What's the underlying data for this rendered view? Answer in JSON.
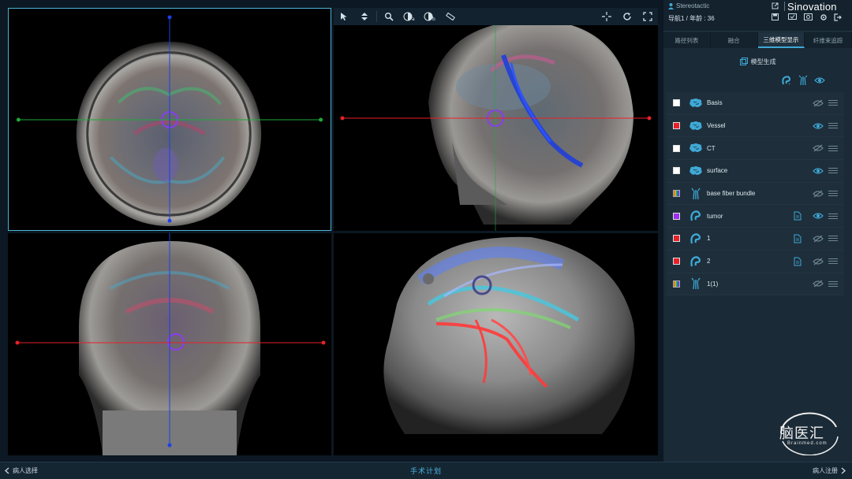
{
  "header": {
    "user": "Stereotactic",
    "patient_info": "导航1 / 年龄 : 36",
    "brand": "Sinovation"
  },
  "tabs": [
    {
      "label": "路径列表",
      "active": false
    },
    {
      "label": "融合",
      "active": false
    },
    {
      "label": "三维模型显示",
      "active": true
    },
    {
      "label": "纤维束追踪",
      "active": false
    }
  ],
  "panel": {
    "generate_label": "模型生成"
  },
  "models": [
    {
      "name": "Basis",
      "color": "#ffffff",
      "icon": "brain-icon",
      "doc": false,
      "visible": false
    },
    {
      "name": "Vessel",
      "color": "#e8202a",
      "icon": "brain-icon",
      "doc": false,
      "visible": true
    },
    {
      "name": "CT",
      "color": "#ffffff",
      "icon": "brain-icon",
      "doc": false,
      "visible": false
    },
    {
      "name": "surface",
      "color": "#ffffff",
      "icon": "brain-icon",
      "doc": false,
      "visible": true
    },
    {
      "name": "base fiber bundle",
      "color": "rainbow",
      "icon": "fiber-icon",
      "doc": false,
      "visible": false
    },
    {
      "name": "tumor",
      "color": "#9b2df0",
      "icon": "tumor-icon",
      "doc": true,
      "visible": true
    },
    {
      "name": "1",
      "color": "#e8202a",
      "icon": "tumor-icon",
      "doc": true,
      "visible": false
    },
    {
      "name": "2",
      "color": "#e8202a",
      "icon": "tumor-icon",
      "doc": true,
      "visible": false
    },
    {
      "name": "1(1)",
      "color": "rainbow",
      "icon": "fiber-icon",
      "doc": false,
      "visible": false
    }
  ],
  "bottom": {
    "prev_label": "病人选择",
    "center_label": "手术计划",
    "next_label": "病人注册"
  },
  "watermark": {
    "title": "脑医汇",
    "subtitle": "Brainmed.com"
  },
  "colors": {
    "accent": "#3fa9d6",
    "panel_bg": "#1a2a36",
    "crosshair_red": "#e8202a",
    "crosshair_green": "#1fa83a",
    "crosshair_blue": "#1f3fe8"
  }
}
